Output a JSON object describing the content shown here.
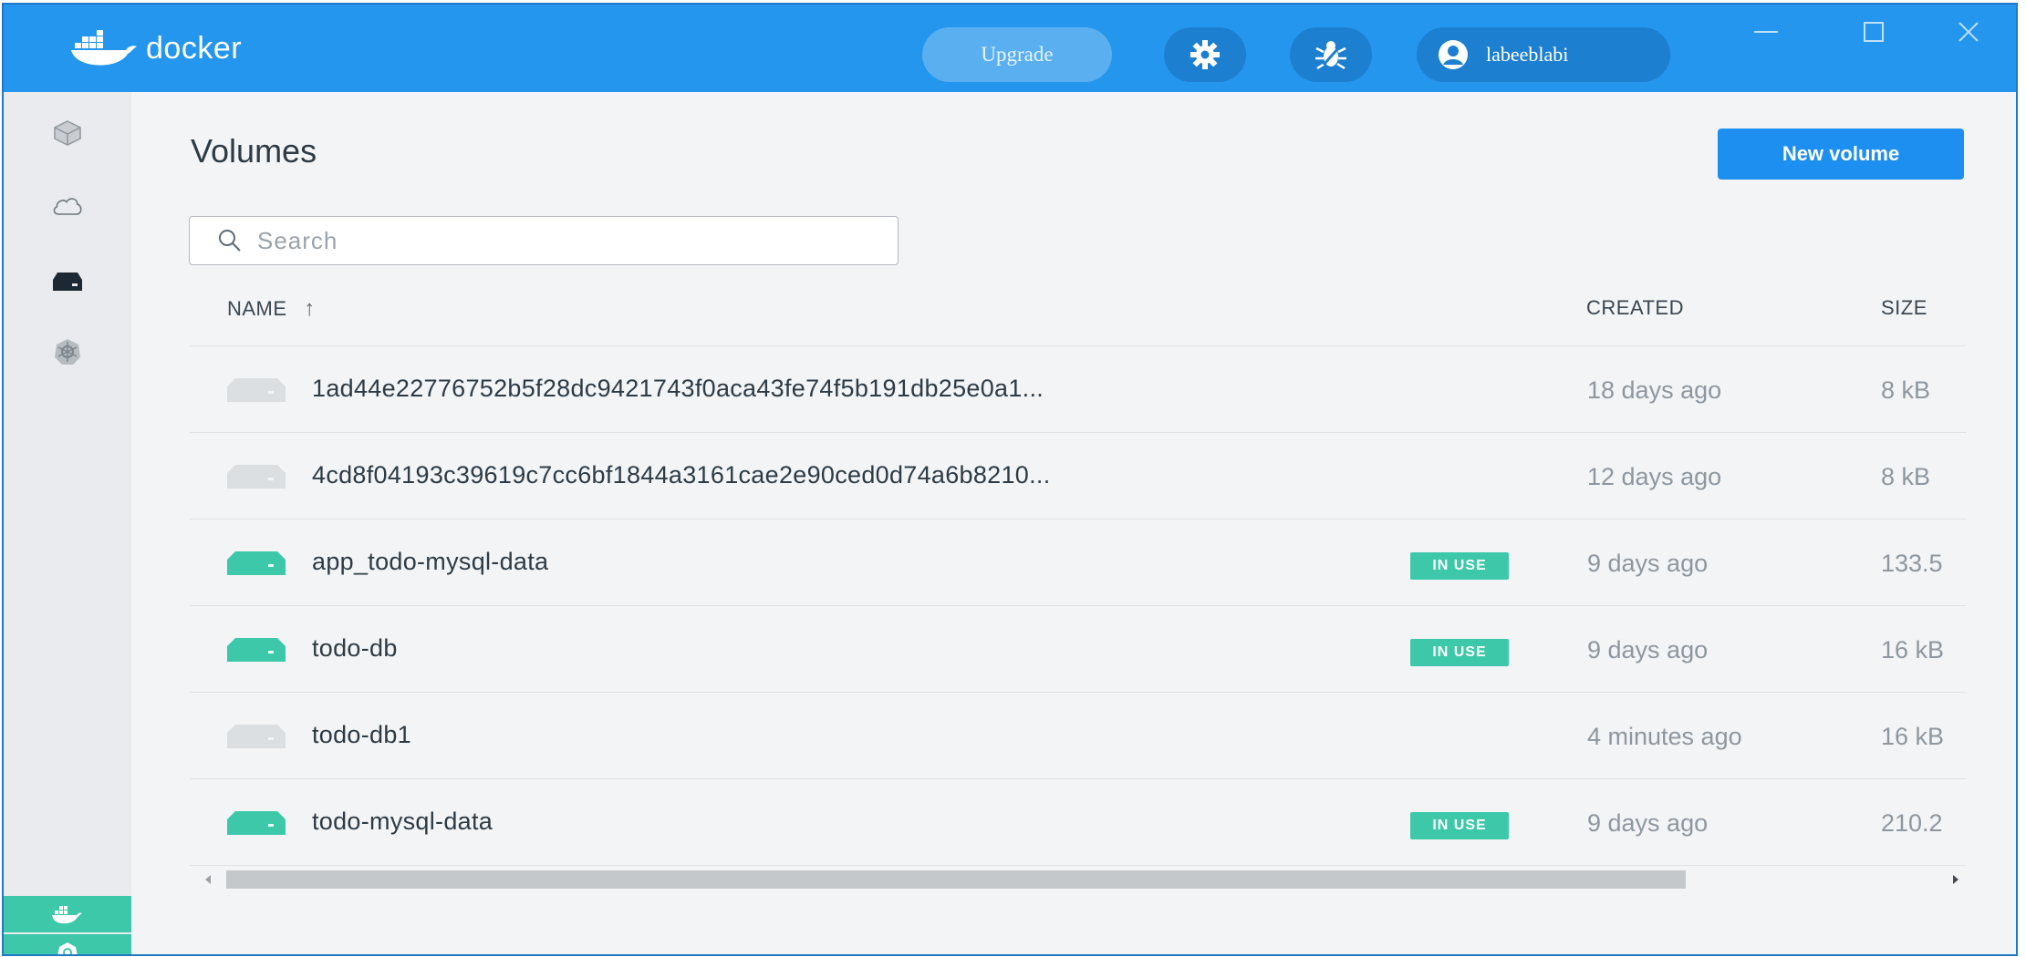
{
  "app": {
    "name": "docker"
  },
  "header": {
    "upgrade_label": "Upgrade",
    "username": "labeeblabi",
    "icons": [
      "settings-gear-icon",
      "bug-icon",
      "user-avatar-icon"
    ],
    "window_controls": [
      "minimize",
      "maximize",
      "close"
    ]
  },
  "sidebar": {
    "items": [
      "containers-icon",
      "cloud-icon",
      "volumes-icon",
      "kubernetes-icon"
    ],
    "bottom": [
      "docker-whale-icon",
      "kubernetes-status-icon"
    ]
  },
  "page": {
    "title": "Volumes",
    "new_volume_label": "New volume"
  },
  "search": {
    "placeholder": "Search",
    "value": ""
  },
  "table": {
    "columns": {
      "name": "NAME",
      "name_sort": "↑",
      "created": "CREATED",
      "size": "SIZE"
    },
    "rows": [
      {
        "name": "1ad44e22776752b5f28dc9421743f0aca43fe74f5b191db25e0a1...",
        "in_use": false,
        "badge": "",
        "created": "18 days ago",
        "size": "8 kB"
      },
      {
        "name": "4cd8f04193c39619c7cc6bf1844a3161cae2e90ced0d74a6b8210...",
        "in_use": false,
        "badge": "",
        "created": "12 days ago",
        "size": "8 kB"
      },
      {
        "name": "app_todo-mysql-data",
        "in_use": true,
        "badge": "IN USE",
        "created": "9 days ago",
        "size": "133.5"
      },
      {
        "name": "todo-db",
        "in_use": true,
        "badge": "IN USE",
        "created": "9 days ago",
        "size": "16 kB"
      },
      {
        "name": "todo-db1",
        "in_use": false,
        "badge": "",
        "created": "4 minutes ago",
        "size": "16 kB"
      },
      {
        "name": "todo-mysql-data",
        "in_use": true,
        "badge": "IN USE",
        "created": "9 days ago",
        "size": "210.2"
      }
    ]
  },
  "colors": {
    "brand": "#2496ed",
    "in_use": "#3dc9a9",
    "idle_volume": "#dcdfe2",
    "primary_button": "#1d8ff0"
  }
}
